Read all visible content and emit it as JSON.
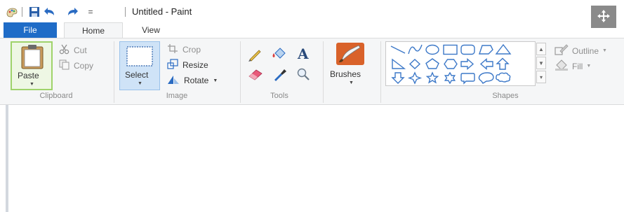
{
  "window": {
    "title": "Untitled - Paint"
  },
  "quick_access": {
    "icons": [
      "paint-app-icon",
      "save-icon",
      "undo-icon",
      "redo-icon",
      "customize-qat-icon"
    ],
    "customize_glyph": "="
  },
  "tabs": {
    "file": "File",
    "home": "Home",
    "view": "View",
    "active": "Home"
  },
  "clipboard": {
    "paste": "Paste",
    "cut": "Cut",
    "copy": "Copy",
    "group_label": "Clipboard"
  },
  "image": {
    "select": "Select",
    "crop": "Crop",
    "resize": "Resize",
    "rotate": "Rotate",
    "group_label": "Image"
  },
  "tools": {
    "icons": [
      "pencil-icon",
      "fill-bucket-icon",
      "text-icon",
      "eraser-icon",
      "color-picker-icon",
      "magnifier-icon"
    ],
    "group_label": "Tools"
  },
  "brushes": {
    "label": "Brushes"
  },
  "shapes": {
    "outline": "Outline",
    "fill": "Fill",
    "group_label": "Shapes",
    "items": [
      "line",
      "curve",
      "oval",
      "rectangle",
      "rounded-rectangle",
      "polygon",
      "triangle",
      "right-triangle",
      "diamond",
      "pentagon",
      "hexagon",
      "right-arrow",
      "left-arrow",
      "up-arrow",
      "down-arrow",
      "four-point-star",
      "five-point-star",
      "six-point-star",
      "rounded-callout",
      "oval-callout",
      "cloud-callout"
    ]
  },
  "colors": {
    "file_tab": "#1f6cc7",
    "ribbon_bg": "#f5f6f7",
    "shape_stroke": "#3c78c8",
    "paste_highlight": "#9fd36b",
    "select_highlight": "#cfe3f7"
  }
}
